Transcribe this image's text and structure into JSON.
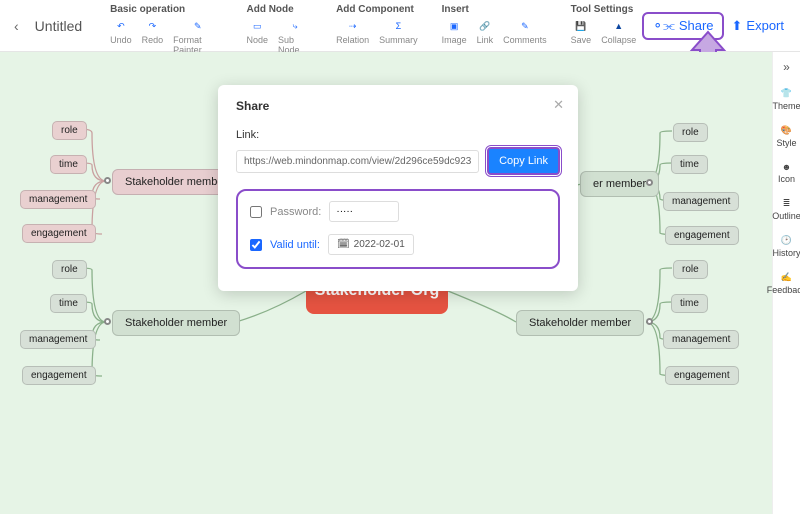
{
  "header": {
    "title": "Untitled",
    "groups": {
      "basic": {
        "title": "Basic operation",
        "undo": "Undo",
        "redo": "Redo",
        "fmt": "Format Painter"
      },
      "addnode": {
        "title": "Add Node",
        "node": "Node",
        "sub": "Sub Node"
      },
      "addcomp": {
        "title": "Add Component",
        "rel": "Relation",
        "sum": "Summary"
      },
      "insert": {
        "title": "Insert",
        "img": "Image",
        "link": "Link",
        "comm": "Comments"
      },
      "tool": {
        "title": "Tool Settings",
        "save": "Save",
        "coll": "Collapse"
      }
    },
    "share": "Share",
    "export": "Export"
  },
  "rail": {
    "theme": "Theme",
    "style": "Style",
    "icon": "Icon",
    "outline": "Outline",
    "history": "History",
    "feedback": "Feedback"
  },
  "map": {
    "center": "Stakeholder Org",
    "member": "Stakeholder member",
    "membershort": "er member",
    "leaves": [
      "role",
      "time",
      "management",
      "engagement"
    ]
  },
  "dialog": {
    "title": "Share",
    "link_label": "Link:",
    "link_value": "https://web.mindonmap.com/view/2d296ce59dc923",
    "copy": "Copy Link",
    "password_label": "Password:",
    "password_value": "·····",
    "valid_label": "Valid until:",
    "valid_value": "2022-02-01"
  }
}
